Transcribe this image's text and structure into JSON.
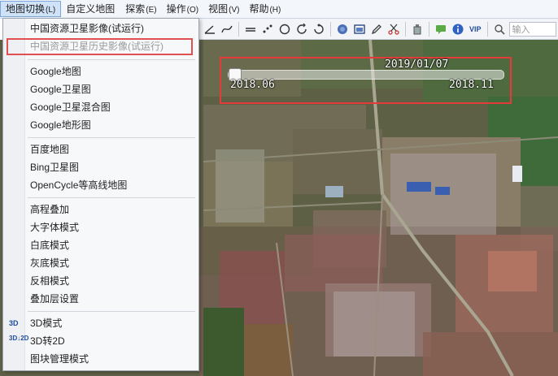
{
  "menubar": {
    "items": [
      {
        "label": "地图切换",
        "accel": "(L)"
      },
      {
        "label": "自定义地图",
        "accel": ""
      },
      {
        "label": "探索",
        "accel": "(E)"
      },
      {
        "label": "操作",
        "accel": "(O)"
      },
      {
        "label": "视图",
        "accel": "(V)"
      },
      {
        "label": "帮助",
        "accel": "(H)"
      }
    ]
  },
  "toolbar": {
    "vip_label": "VIP",
    "search_placeholder": "输入"
  },
  "timeline": {
    "current_date": "2019/01/07",
    "start_label": "2018.06",
    "end_label": "2018.11",
    "position": 0.0
  },
  "dropdown": {
    "items": [
      {
        "label": "中国资源卫星影像(试运行)",
        "icon": ""
      },
      {
        "label": "中国资源卫星历史影像(试运行)",
        "icon": ""
      },
      {
        "label": "Google地图",
        "icon": ""
      },
      {
        "label": "Google卫星图",
        "icon": ""
      },
      {
        "label": "Google卫星混合图",
        "icon": ""
      },
      {
        "label": "Google地形图",
        "icon": ""
      },
      {
        "label": "百度地图",
        "icon": ""
      },
      {
        "label": "Bing卫星图",
        "icon": ""
      },
      {
        "label": "OpenCycle等高线地图",
        "icon": ""
      },
      {
        "label": "高程叠加",
        "icon": ""
      },
      {
        "label": "大字体模式",
        "icon": ""
      },
      {
        "label": "白底模式",
        "icon": ""
      },
      {
        "label": "灰底模式",
        "icon": ""
      },
      {
        "label": "反相模式",
        "icon": ""
      },
      {
        "label": "叠加层设置",
        "icon": ""
      },
      {
        "label": "3D模式",
        "icon": "3D"
      },
      {
        "label": "3D转2D",
        "icon": "3D↓2D"
      },
      {
        "label": "图块管理模式",
        "icon": ""
      }
    ]
  },
  "colors": {
    "highlight_red": "#e53a3a",
    "menu_active": "#cfe2f7"
  }
}
